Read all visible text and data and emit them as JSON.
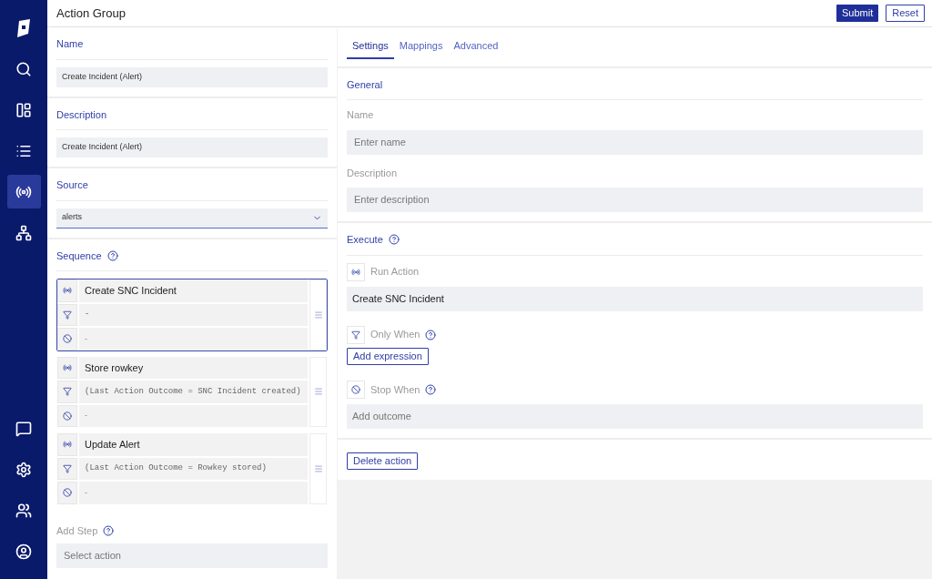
{
  "nav": {
    "top": [
      {
        "kind": "search",
        "selected": false
      },
      {
        "kind": "dashboard",
        "selected": false
      },
      {
        "kind": "list",
        "selected": false
      },
      {
        "kind": "broadcast",
        "selected": true
      },
      {
        "kind": "network",
        "selected": false
      }
    ],
    "bottom": [
      {
        "kind": "chat",
        "selected": false
      },
      {
        "kind": "settings",
        "selected": false
      },
      {
        "kind": "users",
        "selected": false
      },
      {
        "kind": "account",
        "selected": false
      }
    ]
  },
  "header": {
    "title": "Action Group",
    "buttons": [
      {
        "label": "Submit",
        "kind": "primary"
      },
      {
        "label": "Reset",
        "kind": "outline"
      }
    ]
  },
  "left": {
    "name": {
      "label": "Name",
      "value": "Create Incident (Alert)"
    },
    "description": {
      "label": "Description",
      "value": "Create Incident (Alert)"
    },
    "source": {
      "label": "Source",
      "value": "alerts"
    },
    "sequence": {
      "label": "Sequence",
      "steps": [
        {
          "action": "Create SNC Incident",
          "only_when": "-",
          "stop_when": "-",
          "selected": true
        },
        {
          "action": "Store rowkey",
          "only_when": "(Last Action Outcome = SNC Incident created)",
          "stop_when": "-",
          "selected": false
        },
        {
          "action": "Update Alert",
          "only_when": "(Last Action Outcome = Rowkey stored)",
          "stop_when": "-",
          "selected": false
        }
      ]
    },
    "add_step": {
      "label": "Add Step",
      "placeholder": "Select action"
    }
  },
  "right": {
    "tabs": [
      {
        "label": "Settings",
        "selected": true
      },
      {
        "label": "Mappings",
        "selected": false
      },
      {
        "label": "Advanced",
        "selected": false
      }
    ],
    "general": {
      "title": "General",
      "name": {
        "label": "Name",
        "placeholder": "Enter name"
      },
      "description": {
        "label": "Description",
        "placeholder": "Enter description"
      }
    },
    "execute": {
      "title": "Execute",
      "run_action": {
        "label": "Run Action",
        "value": "Create SNC Incident"
      },
      "only_when": {
        "label": "Only When",
        "button": "Add expression"
      },
      "stop_when": {
        "label": "Stop When",
        "placeholder": "Add outcome"
      }
    },
    "delete_button": "Delete action"
  }
}
